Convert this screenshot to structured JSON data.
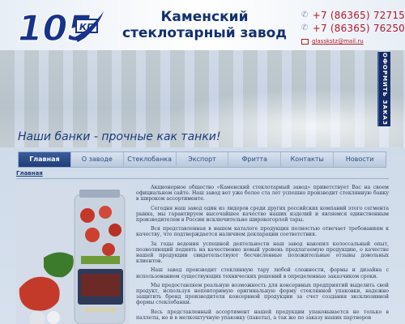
{
  "header": {
    "logo_text": "105 КП",
    "company_line1": "Каменский",
    "company_line2": "стеклотарный завод",
    "phone1": "+7 (86365) 72715",
    "phone2": "+7 (86365) 76250",
    "email": "glasskstz@mail.ru"
  },
  "banner": {
    "slogan": "Наши банки - прочные как танки!",
    "order_tab": "ОФОРМИТЬ ЗАКАЗ"
  },
  "nav": {
    "items": [
      {
        "label": "Главная"
      },
      {
        "label": "О заводе"
      },
      {
        "label": "Стеклобанка"
      },
      {
        "label": "Экспорт"
      },
      {
        "label": "Фритта"
      },
      {
        "label": "Контакты"
      },
      {
        "label": "Новости"
      }
    ],
    "active_index": 0
  },
  "breadcrumb": "Главная",
  "product": {
    "label": "АССОРТИ"
  },
  "content": {
    "paragraphs": [
      "Акционерное общество «Каменский стеклотарный завод» приветствует Вас на своем официальном сайте. Наш завод вот уже более ста лет успешно производит стеклянную банку в широком ассортименте.",
      "Сегодня наш завод один из лидеров среди других российских компаний этого сегмента рынка, мы гарантируем высочайшее качество наших изделий и являемся единственным производителем в России исключительно широкогорлой тары.",
      "Вся представленная в нашем каталоге продукция полностью отвечает требованиям к качеству, что подтверждается наличием декларации соответствия.",
      "За годы ведения успешной деятельности наш завод накопил колоссальный опыт, позволяющий поднять на качественно новый уровень предлагаемую продукцию, о качестве нашей продукции свидетельствуют бесчисленные положительные отзывы довольных клиентов.",
      "Наш завод производит стеклянную тару любой сложности, формы и дизайна с использованием существующих технических решений в определенные заказчиком сроки.",
      "Мы предоставляем реальную возможность для консервных предприятий выделить свой продукт, используя неповторимую оригинальную форму стеклянной упаковки, надежно защитить бренд производителя консервной продукции за счет создания эксклюзивной формы стеклобанки.",
      "Весь представленный ассортимент нашей продукции упаковывается не только в паллеты, но и в мелкоштучную упаковку (пакеты), а так же по заказу наших партнеров"
    ]
  },
  "colors": {
    "brand_blue": "#13306e",
    "phone_red": "#b3182a",
    "nav_active": "#203d7a"
  }
}
